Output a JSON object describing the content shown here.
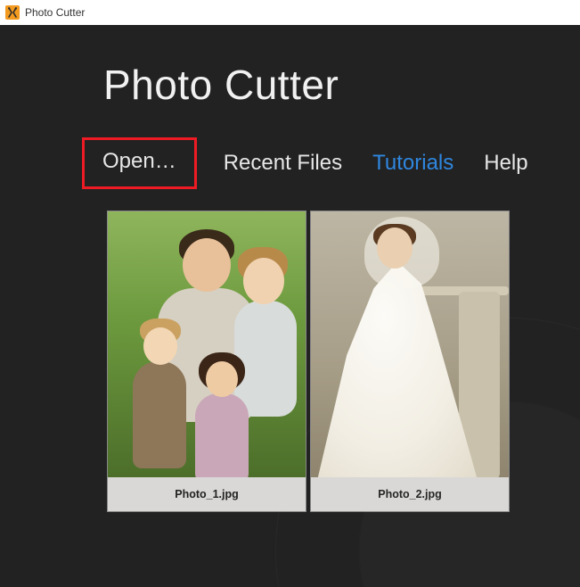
{
  "titlebar": {
    "appname": "Photo Cutter"
  },
  "app": {
    "title": "Photo Cutter"
  },
  "menu": {
    "open": "Open…",
    "recent": "Recent Files",
    "tutorials": "Tutorials",
    "help": "Help"
  },
  "thumbs": [
    {
      "caption": "Photo_1.jpg"
    },
    {
      "caption": "Photo_2.jpg"
    }
  ]
}
